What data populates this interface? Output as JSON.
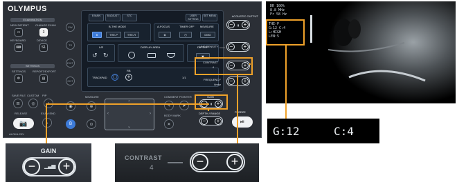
{
  "console": {
    "brand": "OLYMPUS",
    "examination_group": "EXAMINATION",
    "settings_group": "SETTINGS",
    "left_buttons": [
      {
        "label": "NEW PATIENT",
        "glyph": ""
      },
      {
        "label": "CHANGE EXAM",
        "glyph": "3"
      },
      {
        "label": "KEYBOARD",
        "glyph": ""
      },
      {
        "label": "DEVICE",
        "glyph": "S1"
      },
      {
        "label": "SETTINGS",
        "glyph": ""
      },
      {
        "label": "REPORT/EXPORT",
        "glyph": ""
      }
    ],
    "side_round_buttons": [
      "PW",
      "TS",
      "EXIT",
      "CNT"
    ],
    "tabs": [
      "B MAIN",
      "B ADJUST",
      "STC",
      "USER SETTING",
      "SET MENU"
    ],
    "b_mode_section": "B-THE MODE",
    "mode_buttons": [
      "B",
      "THE-P",
      "THE-R"
    ],
    "focus_label": "A-FOCUS",
    "timer_label": "TIMER OFF",
    "measure_label": "MEASURE",
    "measure_value": "DMG",
    "lr_label": "L/R",
    "display_area_label": "DISPLAY AREA",
    "dif_label": "DIF OFF",
    "trackpad_label": "TRACKPAD",
    "rb_label": "RB",
    "screen_small_values": [
      "1/1"
    ],
    "acoustic_output_label": "ACOUSTIC OUTPUT",
    "line_density_label": "LINE DENSITY",
    "contrast_label": "CONTRAST",
    "contrast_value": "4",
    "frequency_label": "FREQUENCY",
    "frequency_value": "6mhz",
    "gain_label": "GAIN",
    "depth_range_label": "DEPTH / RANGE",
    "bottom_left_labels": [
      "SAVE FILE",
      "CUSTOM",
      "PIP"
    ],
    "bottom_mid_labels": [
      "MEASURE",
      "COMMENT",
      "POINTER",
      "BODY MARK",
      "ERASE"
    ],
    "release_label": "RELEASE",
    "exam_end_label": "EXAM END",
    "freeze_label": "FREEZE",
    "footer_small": "ALOKA-20V",
    "pill_mid": "—"
  },
  "ultrasound": {
    "overlay_top": [
      "DR 100%",
      "8.8 MHz",
      "Fr 58 Hz"
    ],
    "overlay_params": [
      "THE-P",
      "G:12 C:4",
      "L:HIGH",
      "LEN:5"
    ]
  },
  "zoom": {
    "gain_title": "GAIN",
    "contrast_title": "CONTRAST",
    "contrast_value": "4",
    "gain_readout": "G:12",
    "contrast_readout": "C:4"
  },
  "colors": {
    "highlight": "#f0a22a",
    "active_blue": "#3d7bd8"
  }
}
